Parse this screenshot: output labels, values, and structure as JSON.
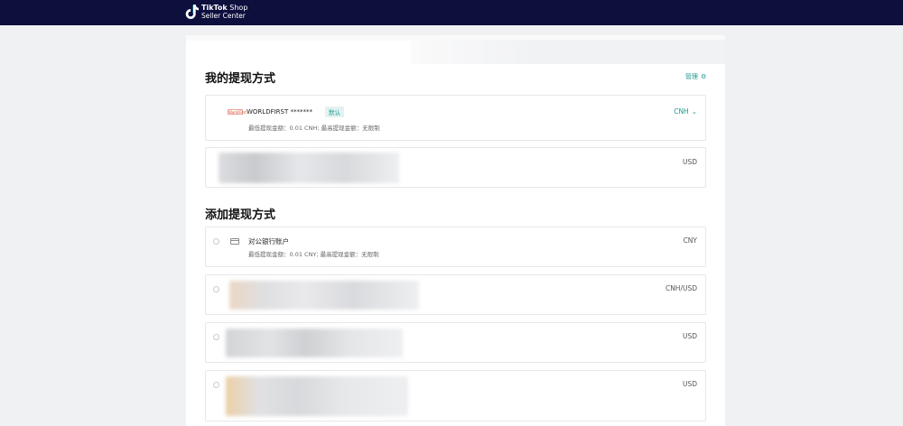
{
  "header": {
    "brand_bold": "TikTok",
    "brand_light": "Shop",
    "brand_sub": "Seller Center"
  },
  "my_methods": {
    "title": "我的提现方式",
    "manage_label": "管理",
    "accounts": [
      {
        "logo_text": "WorldFirst",
        "name": "WORLDFIRST *******",
        "badge": "默认",
        "limit": "最低提现金额：0.01 CNH; 最高提现金额：无限制",
        "currency": "CNH"
      },
      {
        "currency": "USD"
      }
    ]
  },
  "add_methods": {
    "title": "添加提现方式",
    "options": [
      {
        "name": "对公银行账户",
        "limit": "最低提现金额：0.01 CNY; 最高提现金额：无限制",
        "currency": "CNY"
      },
      {
        "currency": "CNH/USD"
      },
      {
        "currency": "USD"
      },
      {
        "currency": "USD"
      }
    ]
  },
  "colors": {
    "topbar": "#0d0f3d",
    "accent": "#1a9a8e",
    "page_bg": "#f0f1f3"
  },
  "icons": [
    "tiktok-logo-icon",
    "gear-icon",
    "chevron-down-icon",
    "bank-card-icon",
    "radio-icon"
  ]
}
